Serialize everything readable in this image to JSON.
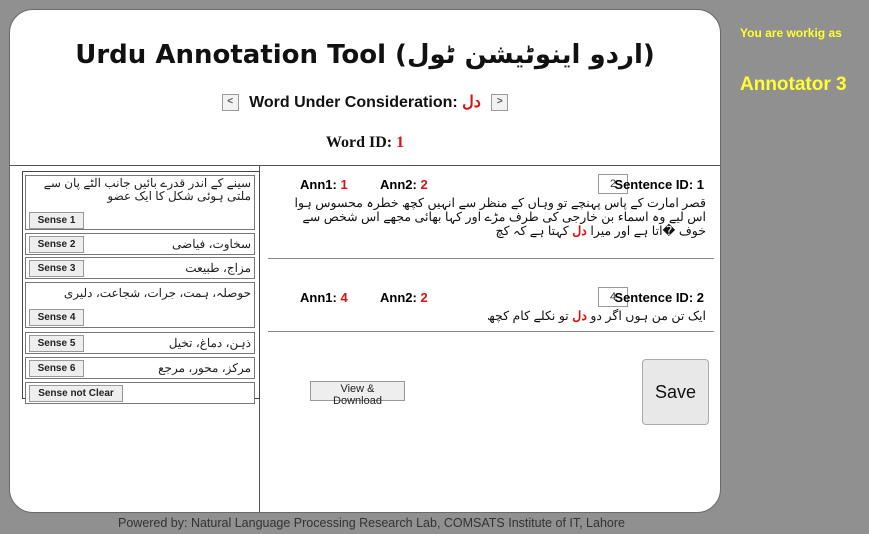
{
  "header": {
    "title": "Urdu Annotation Tool (اردو اینوٹیشن ٹول)",
    "word_label": "Word Under Consideration:",
    "word": "دل",
    "prev": "<",
    "next": ">",
    "word_id_label": "Word ID:",
    "word_id": "1"
  },
  "senses": [
    {
      "text": "سینے کے اندر قدرے بائیں جانب الٹے پان سے ملتی ہوئی شکل کا ایک عضو",
      "button": "Sense 1"
    },
    {
      "text": "سخاوت، فیاضی",
      "button": "Sense 2"
    },
    {
      "text": "مزاج، طبیعت",
      "button": "Sense 3"
    },
    {
      "text": "حوصلہ، ہمت، جرات، شجاعت، دلیری",
      "button": "Sense 4"
    },
    {
      "text": "ذہن، دماغ، تخیل",
      "button": "Sense 5"
    },
    {
      "text": "مرکز، محور، مرجع",
      "button": "Sense 6"
    },
    {
      "text": "",
      "button": "Sense not Clear"
    }
  ],
  "sentences": [
    {
      "ann1_label": "Ann1:",
      "ann1": "1",
      "ann2_label": "Ann2:",
      "ann2": "2",
      "input_value": "2",
      "sid_label": "Sentence ID: 1",
      "pre": "قصر امارت کے پاس پہنچے تو وہاں کے منظر سے انہیں کچھ خطرہ محسوس ہوا اس لیے وہ اسماء بن خارجی کی طرف مڑے اور کہا بھائی مجھے اس شخص سے خوف �اتا ہے اور میرا",
      "word": "دل",
      "post": "کہتا ہے کہ کچ"
    },
    {
      "ann1_label": "Ann1:",
      "ann1": "4",
      "ann2_label": "Ann2:",
      "ann2": "2",
      "input_value": "4",
      "sid_label": "Sentence ID: 2",
      "pre": "ایک تن من ہوں اگر دو",
      "word": "دل",
      "post": "تو نکلے کام کچھ"
    }
  ],
  "actions": {
    "view_download": "View & Download",
    "save": "Save"
  },
  "footer": "Powered by: Natural Language Processing Research Lab, COMSATS Institute of IT, Lahore",
  "side": {
    "working_as": "You are workig as",
    "role": "Annotator 3"
  },
  "colors": {
    "background": "#909090",
    "accent_red": "#dd1111",
    "side_text": "#ffff33"
  }
}
